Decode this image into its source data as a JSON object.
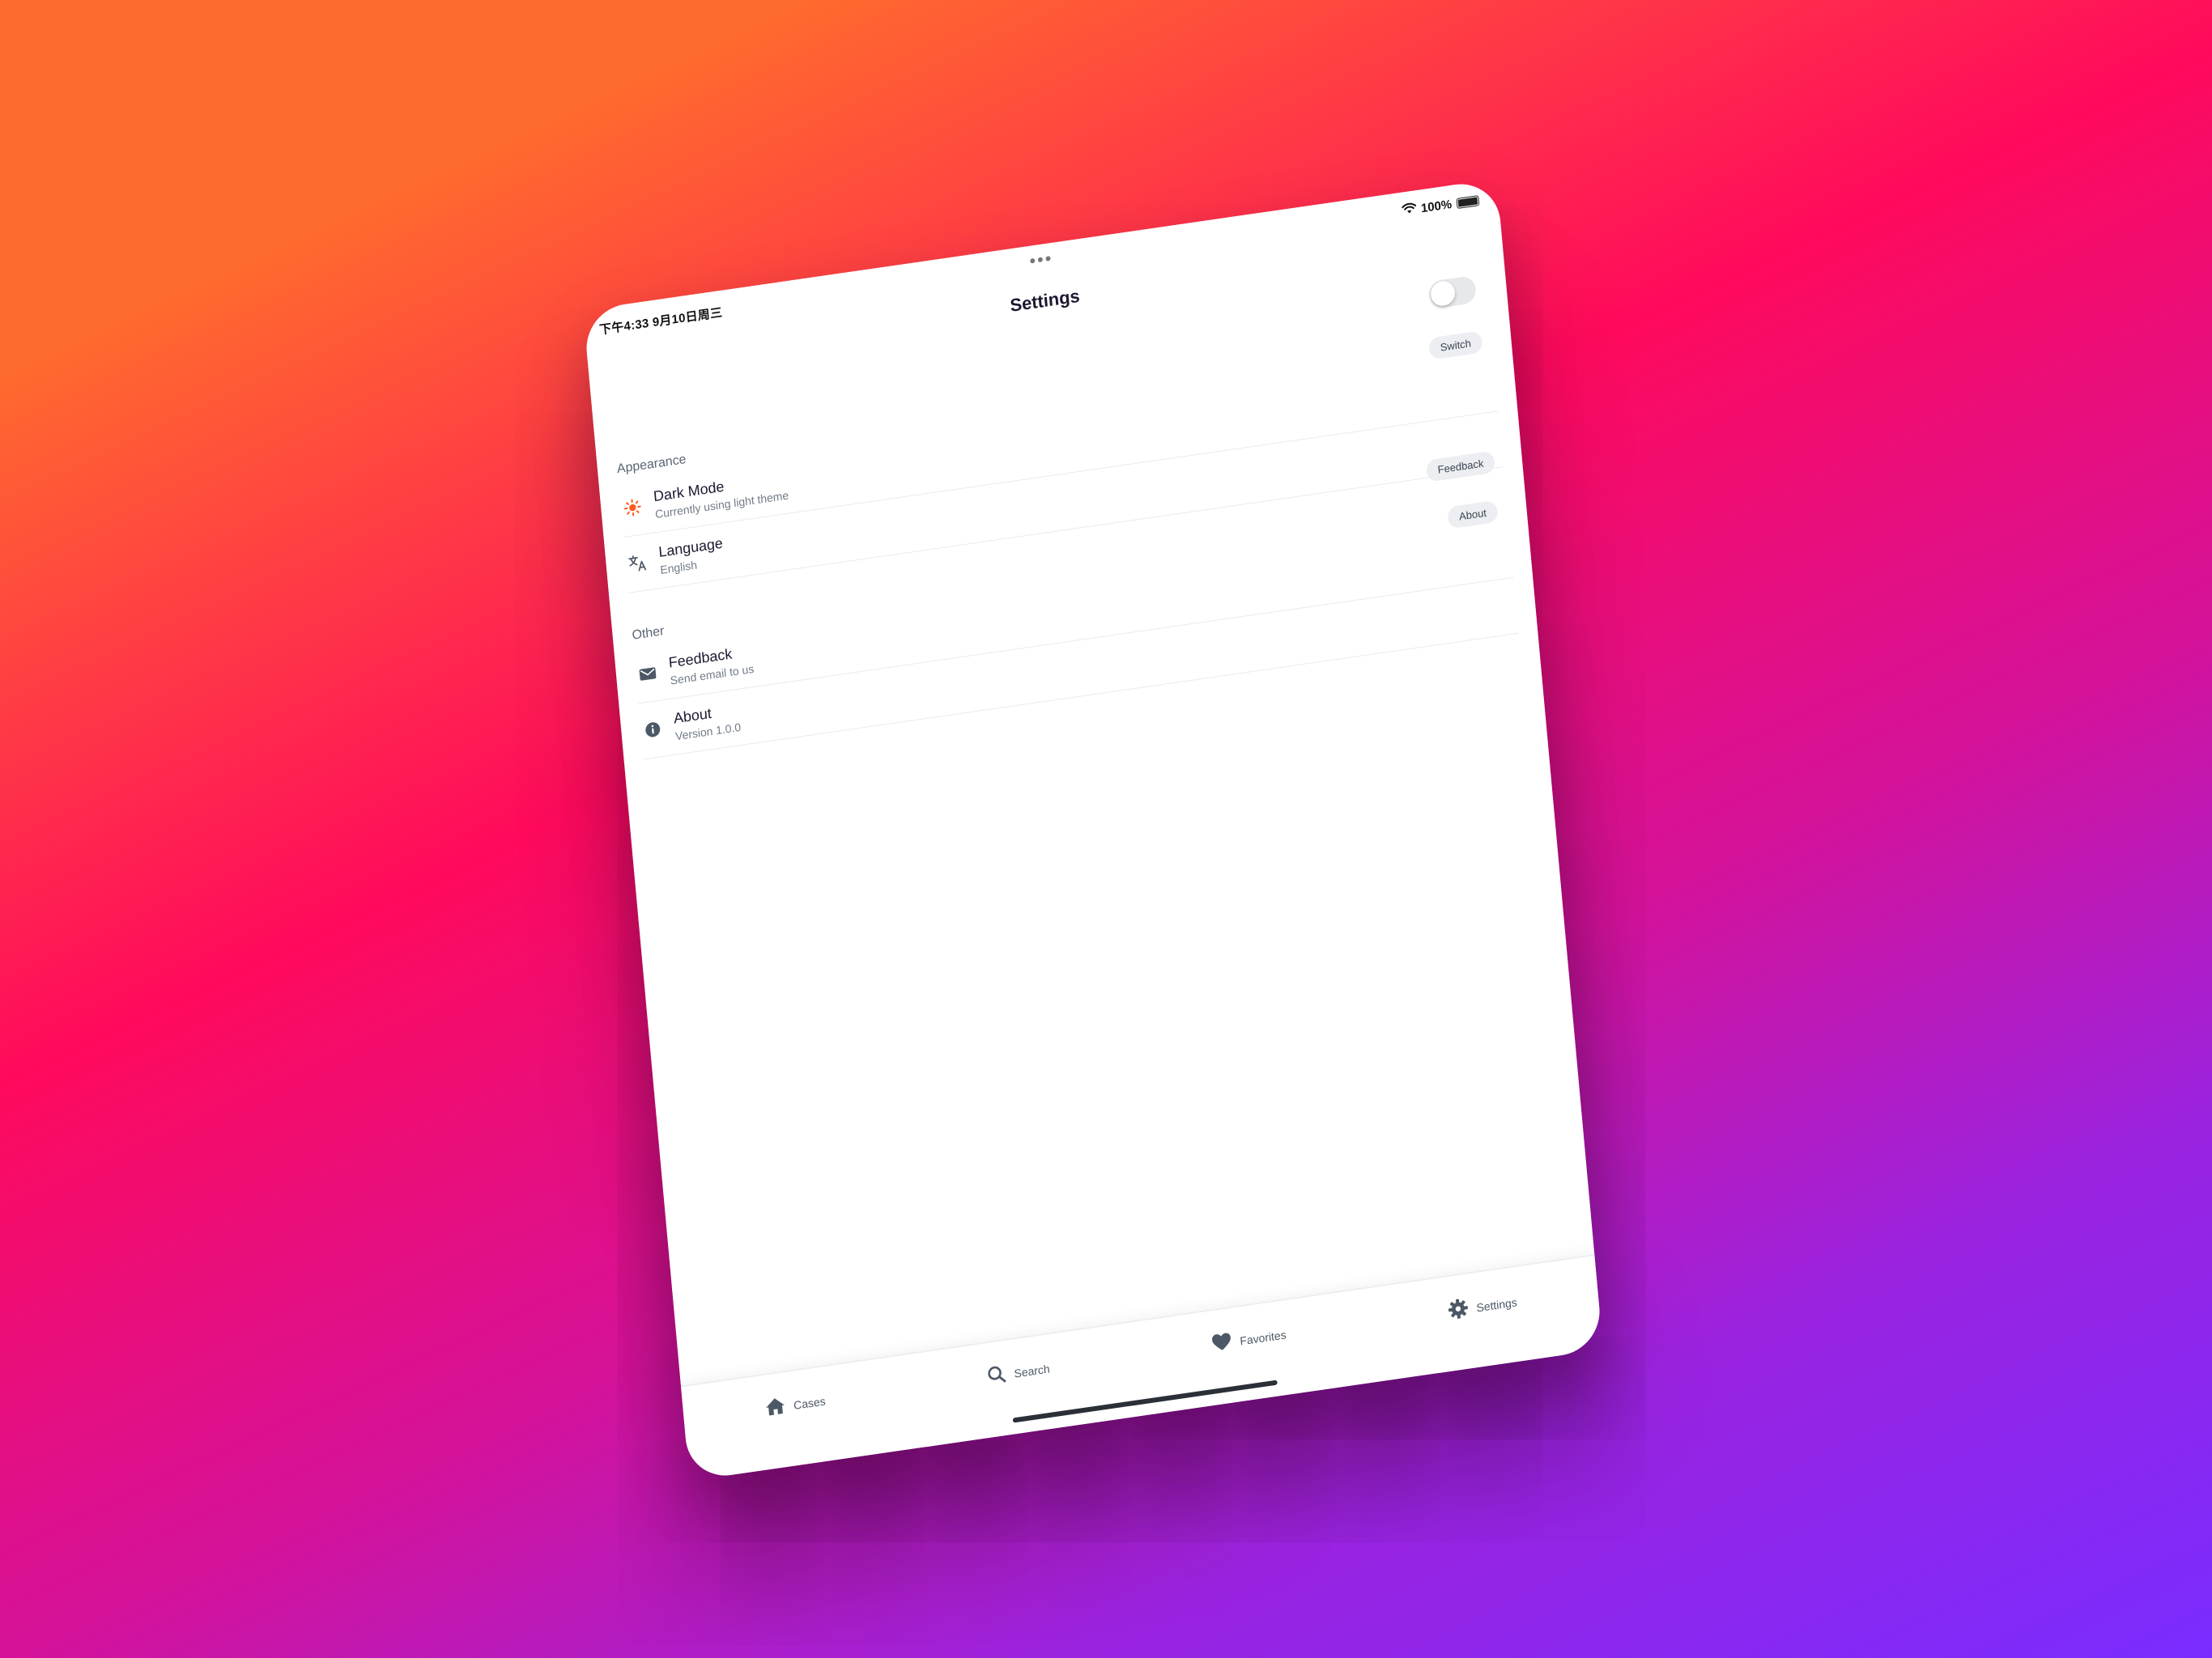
{
  "status_bar": {
    "time": "下午4:33   9月10日周三",
    "battery_percent": "100%",
    "battery_level": 1.0
  },
  "nav": {
    "title": "Settings"
  },
  "toggle": {
    "on": false
  },
  "sections": {
    "appearance": {
      "title": "Appearance",
      "chip": "Switch",
      "rows": [
        {
          "title": "Dark Mode",
          "subtitle": "Currently using light theme",
          "icon": "sun-icon"
        },
        {
          "title": "Language",
          "subtitle": "English",
          "icon": "translate-icon"
        }
      ],
      "footer_chip": "Feedback"
    },
    "other": {
      "title": "Other",
      "chip": "About",
      "rows": [
        {
          "title": "Feedback",
          "subtitle": "Send email to us",
          "icon": "mail-icon"
        },
        {
          "title": "About",
          "subtitle": "Version 1.0.0",
          "icon": "info-icon"
        }
      ]
    }
  },
  "tabs": [
    {
      "label": "Cases",
      "icon": "home-icon"
    },
    {
      "label": "Search",
      "icon": "search-icon"
    },
    {
      "label": "Favorites",
      "icon": "heart-icon"
    },
    {
      "label": "Settings",
      "icon": "gear-icon"
    }
  ],
  "colors": {
    "accent_sun": "#ff5a1f",
    "icon_gray": "#4d5866",
    "title_dark": "#1e1730",
    "background_gradient": [
      "#ff6a2e",
      "#ff0a5c",
      "#d4129a",
      "#7a2cff"
    ]
  }
}
